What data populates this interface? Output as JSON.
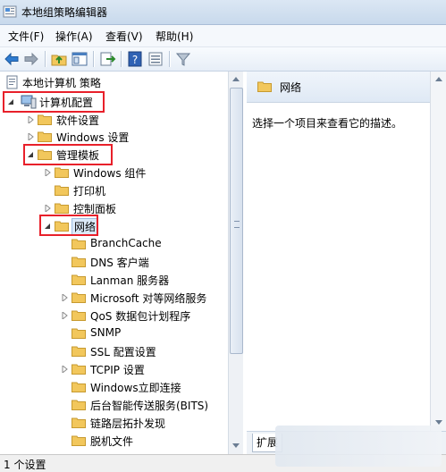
{
  "window": {
    "title": "本地组策略编辑器"
  },
  "menu": [
    "文件(F)",
    "操作(A)",
    "查看(V)",
    "帮助(H)"
  ],
  "toolbar": [
    "back-icon",
    "forward-icon",
    "up-folder-icon",
    "show-hide-tree-icon",
    "export-list-icon",
    "help-icon",
    "properties-icon",
    "filter-icon"
  ],
  "tree": {
    "root": "本地计算机 策略",
    "computer_config": "计算机配置",
    "software_settings": "软件设置",
    "windows_settings": "Windows 设置",
    "admin_templates": "管理模板",
    "windows_components": "Windows 组件",
    "printers": "打印机",
    "control_panel": "控制面板",
    "network": "网络",
    "network_children": [
      "BranchCache",
      "DNS 客户端",
      "Lanman 服务器",
      "Microsoft 对等网络服务",
      "QoS 数据包计划程序",
      "SNMP",
      "SSL 配置设置",
      "TCPIP 设置",
      "Windows立即连接",
      "后台智能传送服务(BITS)",
      "链路层拓扑发现",
      "脱机文件"
    ]
  },
  "right": {
    "header": "网络",
    "description": "选择一个项目来查看它的描述。",
    "tab": "扩展"
  },
  "status": "1 个设置",
  "colors": {
    "highlight_box": "#e8202a",
    "folder": "#f2c75c"
  }
}
